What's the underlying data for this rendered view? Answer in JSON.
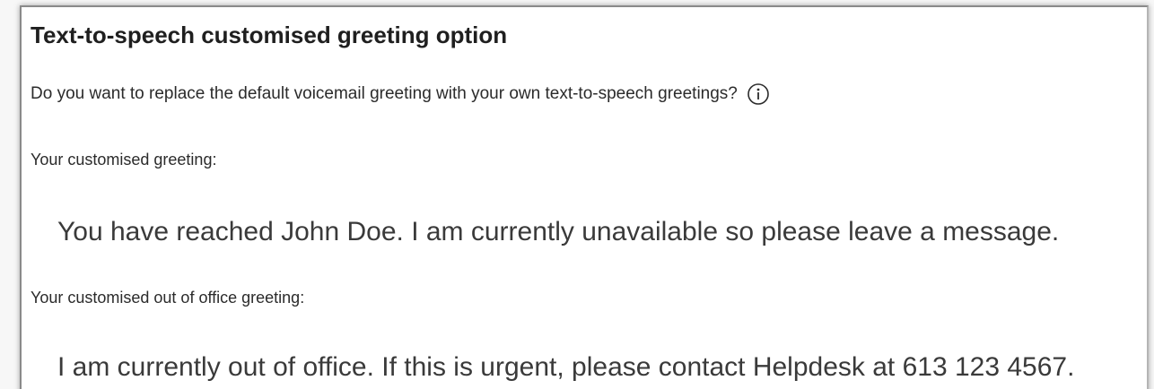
{
  "section": {
    "title": "Text-to-speech customised greeting option",
    "question": "Do you want to replace the default voicemail greeting with your own text-to-speech greetings?",
    "info_icon": "info-circle-icon",
    "greeting_label": "Your customised greeting:",
    "greeting_value": "You have reached John Doe. I am currently unavailable so please leave a message.",
    "ooo_label": "Your customised out of office greeting:",
    "ooo_value": "I am currently out of office. If this is urgent, please contact Helpdesk at 613 123 4567."
  },
  "colors": {
    "text": "#242424",
    "border": "#8a8a8a"
  }
}
